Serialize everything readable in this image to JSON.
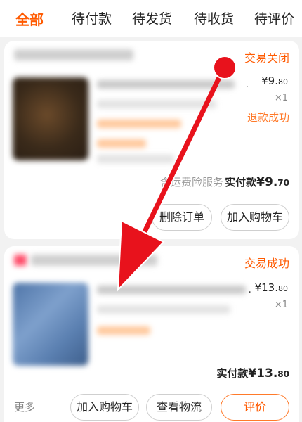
{
  "tabs": [
    {
      "label": "全部",
      "active": true
    },
    {
      "label": "待付款",
      "active": false
    },
    {
      "label": "待发货",
      "active": false
    },
    {
      "label": "待收货",
      "active": false
    },
    {
      "label": "待评价",
      "active": false
    }
  ],
  "order1": {
    "status": "交易关闭",
    "price_main": "¥9.",
    "price_cents": "80",
    "qty": "×1",
    "refund_status": "退款成功",
    "service": "含运费险服务",
    "paid_label": "实付款",
    "paid_main": "¥9.",
    "paid_cents": "70",
    "buttons": [
      "删除订单",
      "加入购物车"
    ]
  },
  "order2": {
    "status": "交易成功",
    "price_main": "¥13.",
    "price_cents": "80",
    "qty": "×1",
    "paid_label": "实付款",
    "paid_main": "¥13.",
    "paid_cents": "80",
    "more": "更多",
    "buttons": [
      "加入购物车",
      "查看物流",
      "评价"
    ]
  },
  "colors": {
    "accent": "#ff5a00",
    "arrow": "#e8121c"
  }
}
